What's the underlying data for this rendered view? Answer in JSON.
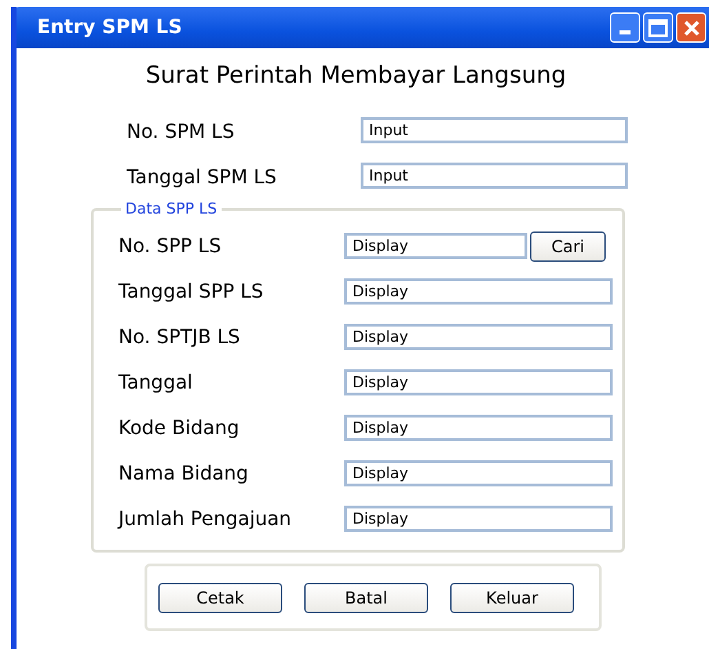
{
  "window": {
    "title": "Entry SPM LS"
  },
  "heading": "Surat Perintah Membayar Langsung",
  "top_fields": [
    {
      "label": "No. SPM LS",
      "value": "Input"
    },
    {
      "label": "Tanggal SPM LS",
      "value": "Input"
    }
  ],
  "group": {
    "legend": "Data SPP LS",
    "fields": [
      {
        "label": "No. SPP LS",
        "value": "Display",
        "button": "Cari"
      },
      {
        "label": "Tanggal SPP LS",
        "value": "Display"
      },
      {
        "label": "No. SPTJB LS",
        "value": "Display"
      },
      {
        "label": "Tanggal",
        "value": "Display"
      },
      {
        "label": "Kode Bidang",
        "value": "Display"
      },
      {
        "label": "Nama Bidang",
        "value": "Display"
      },
      {
        "label": "Jumlah Pengajuan",
        "value": "Display"
      }
    ]
  },
  "buttons": [
    "Cetak",
    "Batal",
    "Keluar"
  ]
}
